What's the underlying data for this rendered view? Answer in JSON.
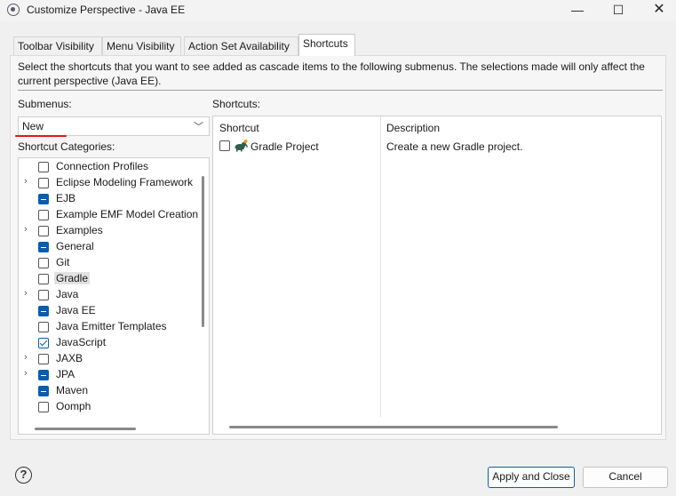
{
  "window": {
    "title": "Customize Perspective - Java EE",
    "min_symbol": "—",
    "max_symbol": "☐",
    "close_symbol": "✕"
  },
  "tabs": [
    {
      "label": "Toolbar Visibility",
      "active": false
    },
    {
      "label": "Menu Visibility",
      "active": false
    },
    {
      "label": "Action Set Availability",
      "active": false
    },
    {
      "label": "Shortcuts",
      "active": true
    }
  ],
  "instructions": "Select the shortcuts that you want to see added as cascade items to the following submenus. The selections made will only affect the current perspective (Java EE).",
  "submenus": {
    "label": "Submenus:",
    "selected": "New",
    "chevron": "﹀"
  },
  "categories": {
    "label": "Shortcut Categories:",
    "twisty_symbol": "›",
    "items": [
      {
        "label": "Connection Profiles",
        "state": "unchecked",
        "expandable": false,
        "selected": false
      },
      {
        "label": "Eclipse Modeling Framework",
        "state": "unchecked",
        "expandable": true,
        "selected": false
      },
      {
        "label": "EJB",
        "state": "partial",
        "expandable": false,
        "selected": false
      },
      {
        "label": "Example EMF Model Creation",
        "state": "unchecked",
        "expandable": false,
        "selected": false
      },
      {
        "label": "Examples",
        "state": "unchecked",
        "expandable": true,
        "selected": false
      },
      {
        "label": "General",
        "state": "partial",
        "expandable": false,
        "selected": false
      },
      {
        "label": "Git",
        "state": "unchecked",
        "expandable": false,
        "selected": false
      },
      {
        "label": "Gradle",
        "state": "unchecked",
        "expandable": false,
        "selected": true
      },
      {
        "label": "Java",
        "state": "unchecked",
        "expandable": true,
        "selected": false
      },
      {
        "label": "Java EE",
        "state": "partial",
        "expandable": false,
        "selected": false
      },
      {
        "label": "Java Emitter Templates",
        "state": "unchecked",
        "expandable": false,
        "selected": false
      },
      {
        "label": "JavaScript",
        "state": "checked",
        "expandable": false,
        "selected": false
      },
      {
        "label": "JAXB",
        "state": "unchecked",
        "expandable": true,
        "selected": false
      },
      {
        "label": "JPA",
        "state": "partial",
        "expandable": true,
        "selected": false
      },
      {
        "label": "Maven",
        "state": "partial",
        "expandable": false,
        "selected": false
      },
      {
        "label": "Oomph",
        "state": "unchecked",
        "expandable": false,
        "selected": false
      }
    ]
  },
  "shortcuts": {
    "label": "Shortcuts:",
    "columns": [
      "Shortcut",
      "Description"
    ],
    "rows": [
      {
        "name": "Gradle Project",
        "description": "Create a new Gradle project.",
        "checked": false,
        "icon": "gradle-elephant-icon"
      }
    ]
  },
  "footer": {
    "help_symbol": "?",
    "apply_label": "Apply and Close",
    "cancel_label": "Cancel"
  },
  "colors": {
    "accent": "#0b5cad",
    "annotation_underline": "#e01818",
    "gradle_icon": "#2f5d50"
  }
}
